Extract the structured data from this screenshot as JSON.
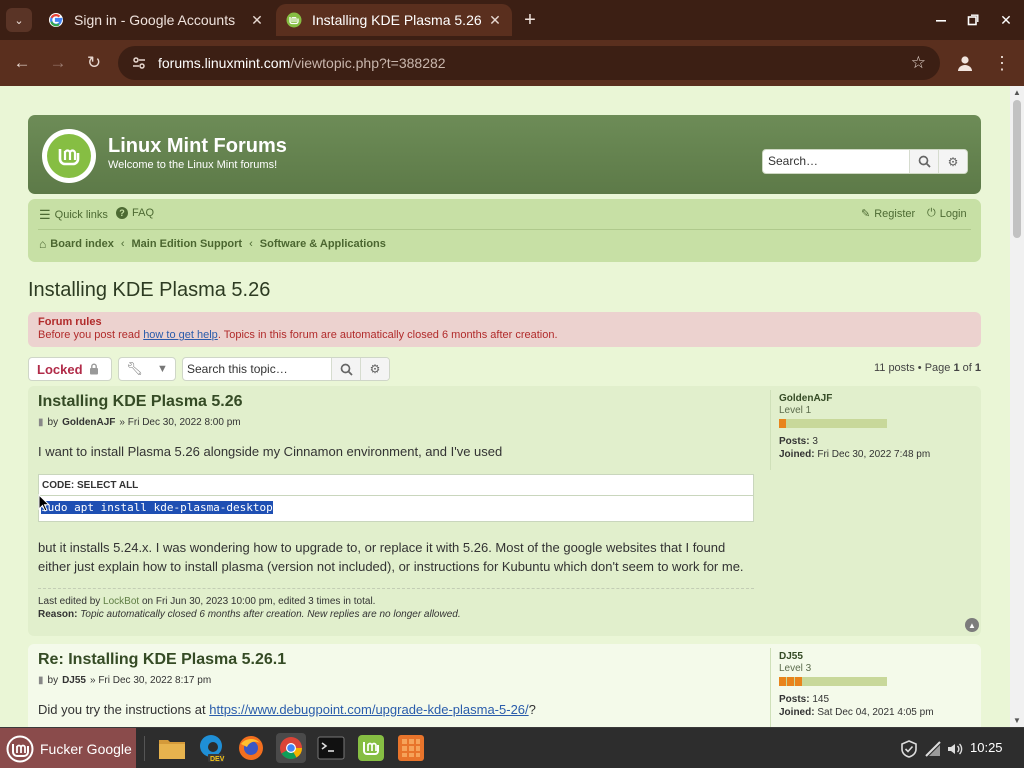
{
  "browser": {
    "tabs": [
      {
        "title": "Sign in - Google Accounts",
        "icon": "google-icon",
        "active": false
      },
      {
        "title": "Installing KDE Plasma 5.26 -",
        "icon": "linuxmint-icon",
        "active": true
      }
    ],
    "url_host": "forums.linuxmint.com",
    "url_path": "/viewtopic.php?t=388282"
  },
  "header": {
    "title": "Linux Mint Forums",
    "description": "Welcome to the Linux Mint forums!",
    "search_placeholder": "Search…"
  },
  "navbar": {
    "quick_links": "Quick links",
    "faq": "FAQ",
    "register": "Register",
    "login": "Login",
    "breadcrumbs": [
      "Board index",
      "Main Edition Support",
      "Software & Applications"
    ]
  },
  "topic": {
    "title": "Installing KDE Plasma 5.26",
    "rules_title": "Forum rules",
    "rules_prefix": "Before you post read ",
    "rules_link": "how to get help",
    "rules_suffix": ". Topics in this forum are automatically closed 6 months after creation.",
    "locked_label": "Locked",
    "search_placeholder": "Search this topic…",
    "pagination_prefix": "11 posts • Page ",
    "page_current": "1",
    "page_of": " of ",
    "page_total": "1"
  },
  "posts": [
    {
      "title": "Installing KDE Plasma 5.26",
      "by": "by",
      "author": "GoldenAJF",
      "date": "» Fri Dec 30, 2022 8:00 pm",
      "text1": "I want to install Plasma 5.26 alongside my Cinnamon environment, and I've used",
      "code_header": "CODE: SELECT ALL",
      "code": "sudo apt install kde-plasma-desktop",
      "text2": "but it installs 5.24.x. I was wondering how to upgrade to, or replace it with 5.26. Most of the google websites that I found either just explain how to install plasma (version not included), or instructions for Kubuntu which don't seem to work for me.",
      "edit_prefix": "Last edited by ",
      "edit_user": "LockBot",
      "edit_suffix": " on Fri Jun 30, 2023 10:00 pm, edited 3 times in total.",
      "reason_label": "Reason:",
      "reason_text": "Topic automatically closed 6 months after creation. New replies are no longer allowed.",
      "profile": {
        "username": "GoldenAJF",
        "rank": "Level 1",
        "rank_level": 1,
        "posts_label": "Posts:",
        "posts": "3",
        "joined_label": "Joined:",
        "joined": "Fri Dec 30, 2022 7:48 pm"
      }
    },
    {
      "title": "Re: Installing KDE Plasma 5.26.1",
      "by": "by",
      "author": "DJ55",
      "date": "» Fri Dec 30, 2022 8:17 pm",
      "text_prefix": "Did you try the instructions at ",
      "link": "https://www.debugpoint.com/upgrade-kde-plasma-5-26/",
      "text_suffix": "?",
      "profile": {
        "username": "DJ55",
        "rank": "Level 3",
        "rank_level": 3,
        "posts_label": "Posts:",
        "posts": "145",
        "joined_label": "Joined:",
        "joined": "Sat Dec 04, 2021 4:05 pm"
      }
    }
  ],
  "taskbar": {
    "start_label": "Fucker Google",
    "apps": [
      "files-icon",
      "edge-dev-icon",
      "firefox-icon",
      "chrome-icon",
      "terminal-icon",
      "mintinstall-icon",
      "grid-app-icon"
    ],
    "clock": "10:25"
  },
  "colors": {
    "page_bg": "#eaf6d6",
    "header_green": "#6d8c57",
    "locked_red": "#b12b48",
    "mint_green": "#86be43"
  }
}
